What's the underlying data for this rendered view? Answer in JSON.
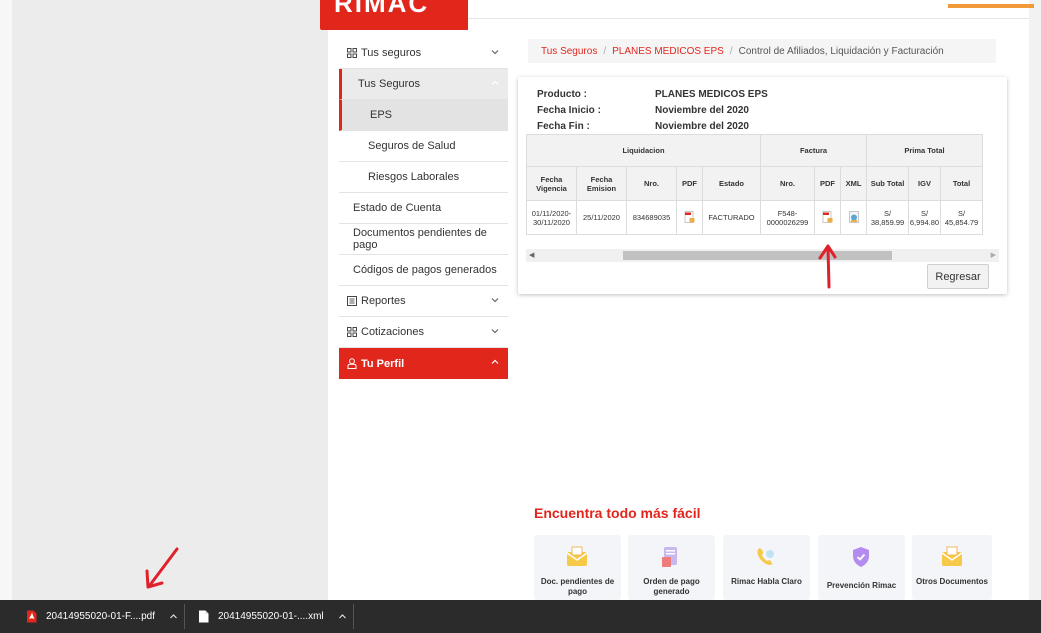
{
  "header": {
    "logo_text": "RIMAC"
  },
  "sidebar": {
    "items": [
      {
        "label": "Tus seguros",
        "icon": "grid-icon"
      },
      {
        "label": "Tus Seguros"
      },
      {
        "label": "EPS"
      },
      {
        "label": "Seguros de Salud"
      },
      {
        "label": "Riesgos Laborales"
      },
      {
        "label": "Estado de Cuenta"
      },
      {
        "label": "Documentos pendientes de pago"
      },
      {
        "label": "Códigos de pagos generados"
      },
      {
        "label": "Reportes",
        "icon": "report-icon"
      },
      {
        "label": "Cotizaciones",
        "icon": "grid-icon"
      },
      {
        "label": "Tu Perfil",
        "icon": "user-icon"
      }
    ]
  },
  "breadcrumb": {
    "items": [
      "Tus Seguros",
      "PLANES MEDICOS EPS",
      "Control de Afiliados, Liquidación y Facturación"
    ],
    "separator": "/"
  },
  "info": {
    "producto_label": "Producto :",
    "producto_value": "PLANES MEDICOS EPS",
    "inicio_label": "Fecha Inicio :",
    "inicio_value": "Noviembre del 2020",
    "fin_label": "Fecha Fin :",
    "fin_value": "Noviembre del 2020"
  },
  "table": {
    "groups": [
      "Liquidacion",
      "Factura",
      "Prima Total"
    ],
    "columns": [
      "Fecha Vigencia",
      "Fecha Emision",
      "Nro.",
      "PDF",
      "Estado",
      "Nro.",
      "PDF",
      "XML",
      "Sub Total",
      "IGV",
      "Total"
    ],
    "row": {
      "vigencia": "01/11/2020-30/11/2020",
      "emision": "25/11/2020",
      "nro": "834689035",
      "estado": "FACTURADO",
      "factura_nro": "F548-0000026299",
      "subtotal": "S/ 38,859.99",
      "igv": "S/ 6,994.80",
      "total": "S/ 45,854.79"
    }
  },
  "buttons": {
    "back": "Regresar"
  },
  "encuentra": {
    "title": "Encuentra todo más fácil",
    "tiles": [
      {
        "label": "Doc. pendientes de pago",
        "icon": "envelope-icon"
      },
      {
        "label": "Orden de pago generado",
        "icon": "document-icon"
      },
      {
        "label": "Rimac Habla Claro",
        "icon": "phone-icon"
      },
      {
        "label": "Prevención Rimac",
        "icon": "shield-icon"
      },
      {
        "label": "Otros Documentos",
        "icon": "envelope-icon"
      }
    ]
  },
  "downloads": {
    "items": [
      {
        "name": "20414955020-01-F....pdf",
        "icon": "pdf-file-icon"
      },
      {
        "name": "20414955020-01-....xml",
        "icon": "file-icon"
      }
    ]
  },
  "colors": {
    "brand": "#e1261c",
    "download_bar": "#2b2b2c"
  }
}
